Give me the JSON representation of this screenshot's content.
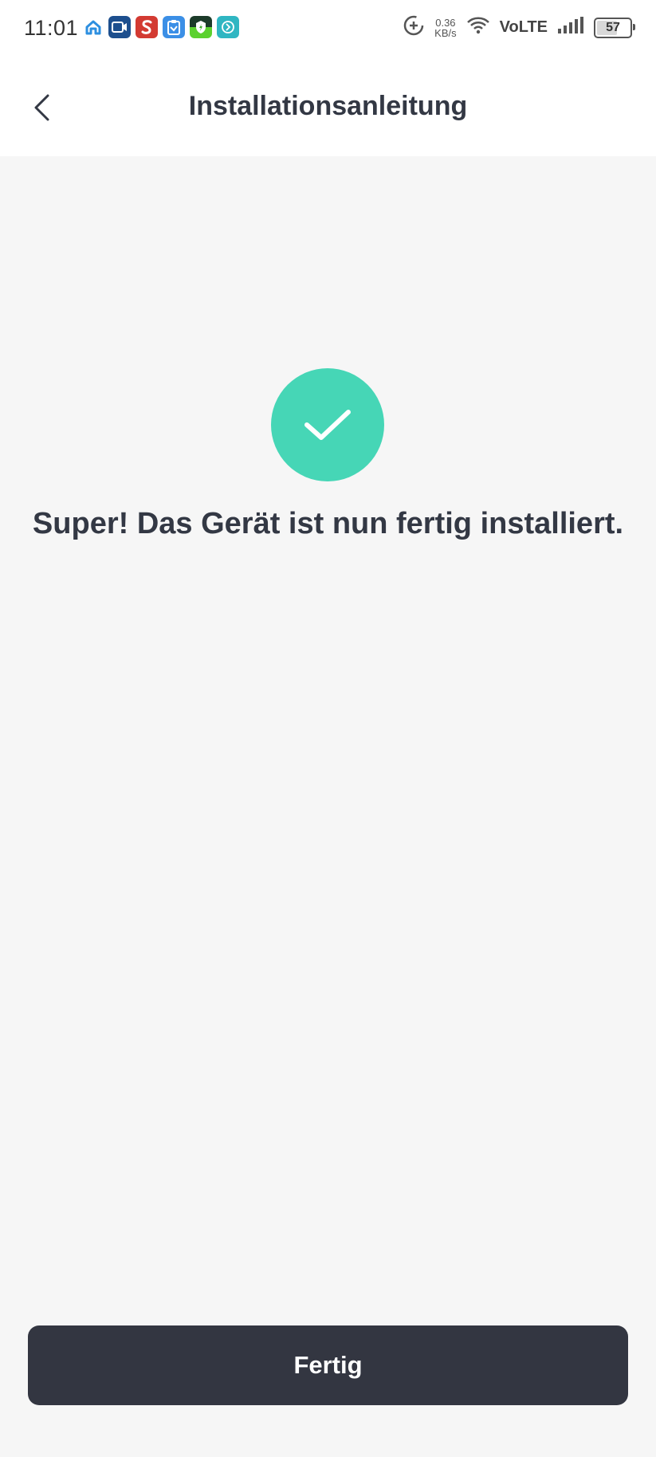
{
  "status_bar": {
    "time": "11:01",
    "net_speed_value": "0.36",
    "net_speed_unit": "KB/s",
    "network_label": "VoLTE",
    "battery_level": "57",
    "notification_icons": [
      "home-icon",
      "screen-record-icon",
      "s-app-icon",
      "clipboard-icon",
      "shield-app-icon",
      "swift-app-icon"
    ]
  },
  "header": {
    "title": "Installationsanleitung"
  },
  "main": {
    "success_message": "Super! Das Gerät ist nun fertig installiert."
  },
  "footer": {
    "done_label": "Fertig"
  },
  "colors": {
    "accent_success": "#46d6b6",
    "button_dark": "#333641",
    "text_dark": "#333844",
    "background": "#f6f6f6"
  }
}
